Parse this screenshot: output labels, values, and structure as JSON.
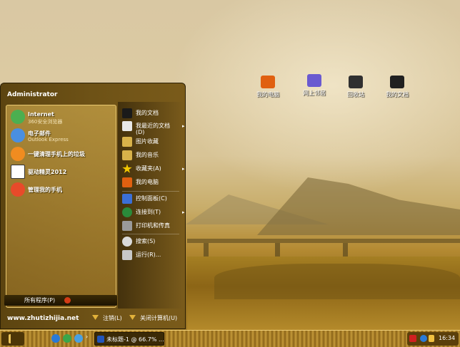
{
  "desktop": {
    "icons": [
      {
        "label": "我的电脑",
        "icon": "computer-icon",
        "color": "#e06010"
      },
      {
        "label": "网上邻居",
        "icon": "network-icon",
        "color": "#6a5ad0"
      },
      {
        "label": "回收站",
        "icon": "recycle-bin-icon",
        "color": "#303030"
      },
      {
        "label": "我的文档",
        "icon": "documents-folder-icon",
        "color": "#202020"
      }
    ]
  },
  "start_menu": {
    "user": "Administrator",
    "programs": [
      {
        "title": "Internet",
        "subtitle": "360安全浏览器",
        "icon": "browser-360-icon",
        "color": "#4caf50"
      },
      {
        "title": "电子邮件",
        "subtitle": "Outlook Express",
        "icon": "outlook-express-icon",
        "color": "#4a8fe0"
      },
      {
        "title": "一键清理手机上的垃圾",
        "subtitle": "",
        "icon": "phone-cleaner-icon",
        "color": "#f08c20"
      },
      {
        "title": "驱动精灵2012",
        "subtitle": "",
        "icon": "driver-genius-icon",
        "color": "#ffffff"
      },
      {
        "title": "管理我的手机",
        "subtitle": "",
        "icon": "phone-manager-icon",
        "color": "#e84a2a"
      }
    ],
    "all_programs": "所有程序(P)",
    "places": [
      {
        "label": "我的文档",
        "icon": "documents-icon",
        "submenu": false
      },
      {
        "label": "我最近的文档(D)",
        "icon": "recent-documents-icon",
        "submenu": true
      },
      {
        "label": "图片收藏",
        "icon": "pictures-icon",
        "submenu": false
      },
      {
        "label": "我的音乐",
        "icon": "music-icon",
        "submenu": false
      },
      {
        "label": "收藏夹(A)",
        "icon": "favorites-star-icon",
        "submenu": true
      },
      {
        "label": "我的电脑",
        "icon": "my-computer-icon",
        "submenu": false
      },
      {
        "label": "控制面板(C)",
        "icon": "control-panel-icon",
        "submenu": false
      },
      {
        "label": "连接到(T)",
        "icon": "connect-to-icon",
        "submenu": true
      },
      {
        "label": "打印机和传真",
        "icon": "printer-icon",
        "submenu": false
      },
      {
        "label": "搜索(S)",
        "icon": "search-icon",
        "submenu": false
      },
      {
        "label": "运行(R)...",
        "icon": "run-icon",
        "submenu": false
      }
    ],
    "website": "www.zhutizhijia.net",
    "logoff": "注销(L)",
    "shutdown": "关闭计算机(U)"
  },
  "taskbar": {
    "task_label": "未标题-1 @ 66.7% ...",
    "tray_icons": [
      "sogou-ime-icon",
      "network-status-icon",
      "security-icon"
    ],
    "clock": "16:34"
  }
}
